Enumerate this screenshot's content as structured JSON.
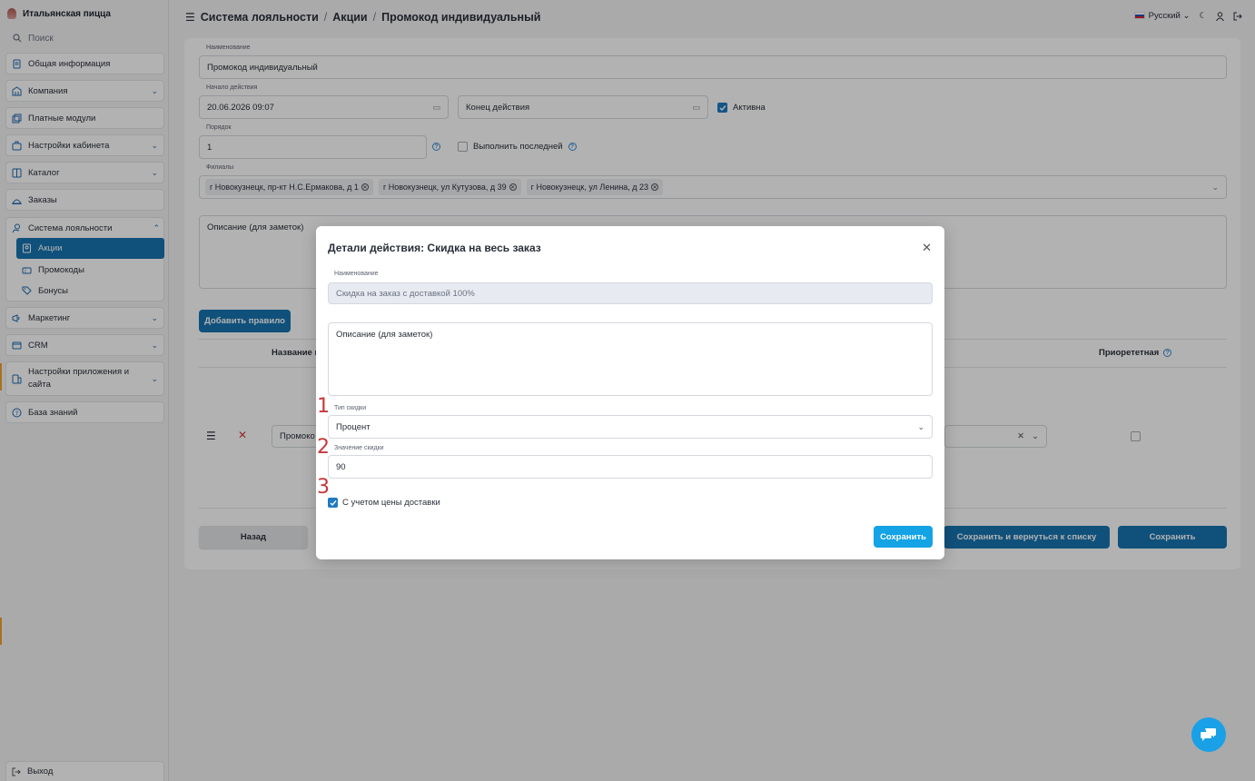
{
  "app": {
    "brand": "Итальянская пицца",
    "search_placeholder": "Поиск"
  },
  "sidebar": {
    "items": [
      {
        "label": "Общая информация"
      },
      {
        "label": "Компания"
      },
      {
        "label": "Платные модули"
      },
      {
        "label": "Настройки кабинета"
      },
      {
        "label": "Каталог"
      },
      {
        "label": "Заказы"
      },
      {
        "label": "Система лояльности"
      },
      {
        "label": "Маркетинг"
      },
      {
        "label": "CRM"
      },
      {
        "label": "Настройки приложения и сайта"
      },
      {
        "label": "База знаний"
      }
    ],
    "loyalty_sub": [
      {
        "label": "Акции"
      },
      {
        "label": "Промокоды"
      },
      {
        "label": "Бонусы"
      }
    ],
    "logout": "Выход"
  },
  "header": {
    "crumbs": [
      "Система лояльности",
      "Акции",
      "Промокод индивидуальный"
    ],
    "separator": "/",
    "language": "Русский"
  },
  "form": {
    "name_label": "Наименование",
    "name_value": "Промокод индивидуальный",
    "start_label": "Начало действия",
    "start_value": "20.06.2026 09:07",
    "end_placeholder": "Конец действия",
    "active_label": "Активна",
    "order_label": "Порядок",
    "order_value": "1",
    "execute_last_label": "Выполнить последней",
    "branches_label": "Филиалы",
    "branches": [
      "г Новокузнецк, пр-кт Н.С.Ермакова, д 1",
      "г Новокузнецк, ул Кутузова, д 39",
      "г Новокузнецк, ул Ленина, д 23"
    ],
    "description_placeholder": "Описание (для заметок)",
    "add_rule": "Добавить правило",
    "table_col_name": "Название п",
    "table_col_priority": "Приорететная",
    "row_value": "Промоко",
    "back": "Назад",
    "save_return": "Сохранить и вернуться к списку",
    "save": "Сохранить"
  },
  "modal": {
    "title": "Детали действия: Скидка на весь заказ",
    "name_label": "Наименование",
    "name_value": "Скидка на заказ с доставкой 100%",
    "description_placeholder": "Описание (для заметок)",
    "discount_type_label": "Тип скидки",
    "discount_type_value": "Процент",
    "discount_value_label": "Значение скидки",
    "discount_value": "90",
    "delivery_label": "С учетом цены доставки",
    "save": "Сохранить",
    "markers": [
      "1",
      "2",
      "3"
    ]
  },
  "colors": {
    "accent": "#1874b0",
    "modal_save": "#14a3e4",
    "marker": "#c8373a"
  }
}
